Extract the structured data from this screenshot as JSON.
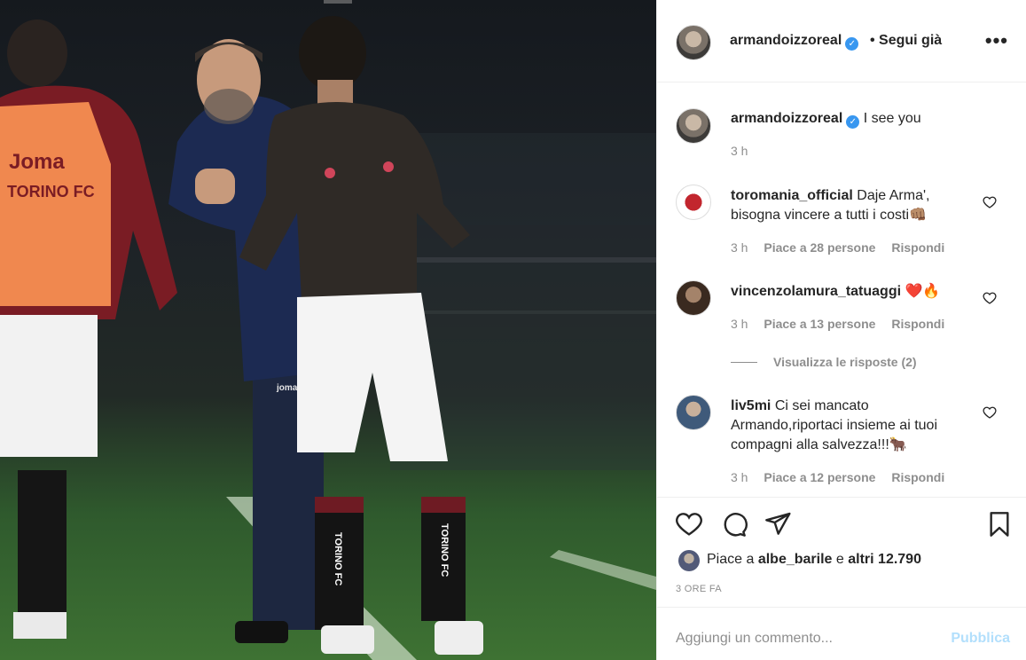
{
  "post": {
    "author": "armandoizzoreal",
    "follow_status": "• Segui già",
    "more_icon": "more-options-icon",
    "photo_alt": "post-photo",
    "photo_text": {
      "bib_brand": "Joma",
      "bib_team": "TORINO FC",
      "sock_text": "TORINO FC",
      "jacket_brand": "joma"
    }
  },
  "caption": {
    "username": "armandoizzoreal",
    "text": "I see you",
    "time": "3 h"
  },
  "comments": [
    {
      "username": "toromania_official",
      "text": "Daje Arma', bisogna vincere a tutti i costi👊🏽",
      "time": "3 h",
      "likes": "Piace a 28 persone",
      "reply": "Rispondi"
    },
    {
      "username": "vincenzolamura_tatuaggi",
      "text": "❤️🔥",
      "time": "3 h",
      "likes": "Piace a 13 persone",
      "reply": "Rispondi",
      "view_replies": "Visualizza le risposte (2)"
    },
    {
      "username": "liv5mi",
      "text": "Ci sei mancato Armando,riportaci insieme ai tuoi compagni alla salvezza!!!🐂",
      "time": "3 h",
      "likes": "Piace a 12 persone",
      "reply": "Rispondi"
    }
  ],
  "actions": {
    "like_prefix": "Piace a",
    "like_user": "albe_barile",
    "like_mid": "e",
    "like_rest": "altri 12.790",
    "post_time": "3 ORE FA"
  },
  "add_comment": {
    "placeholder": "Aggiungi un commento...",
    "publish": "Pubblica"
  },
  "colors": {
    "verified": "#3897f0",
    "publish_disabled": "#b2dffc",
    "muted": "#8e8e8e",
    "text": "#262626"
  }
}
